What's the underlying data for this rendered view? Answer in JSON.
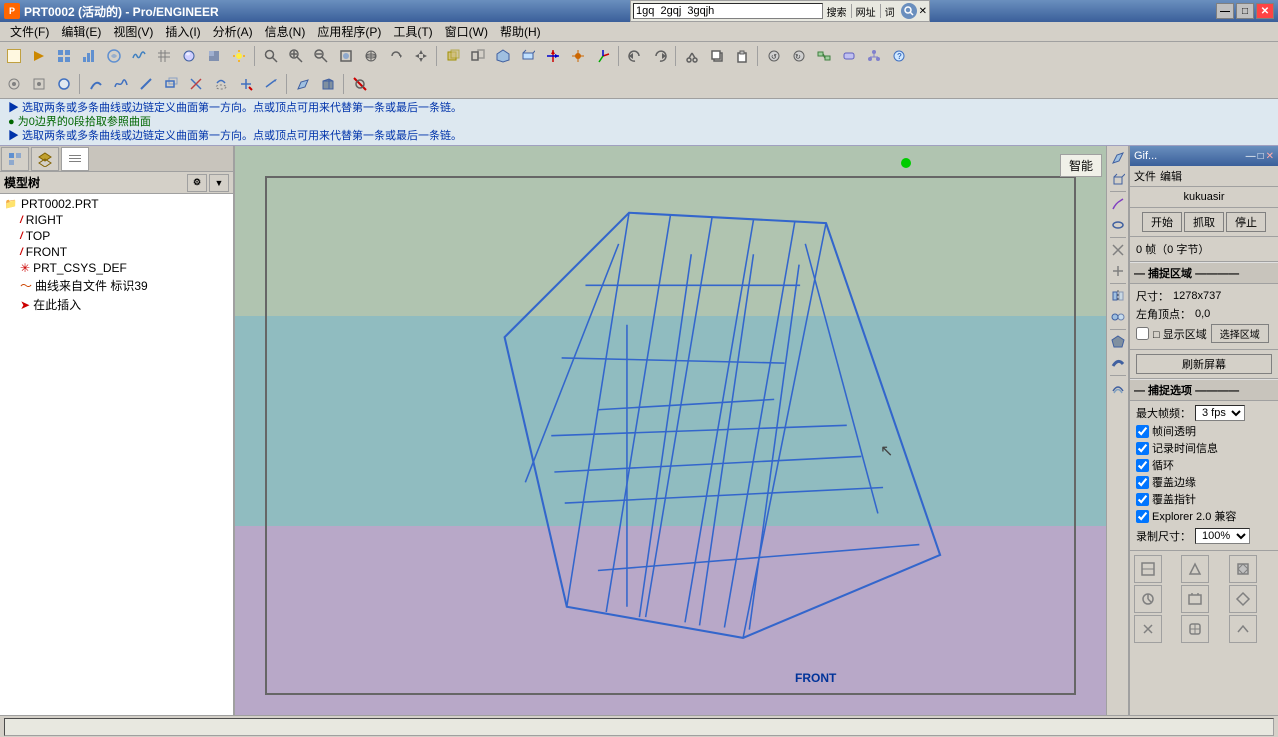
{
  "titleBar": {
    "title": "PRT0002 (活动的) - Pro/ENGINEER",
    "minimizeLabel": "—",
    "maximizeLabel": "□",
    "closeLabel": "✕"
  },
  "searchBar": {
    "text": "1gq  2gqj  3gqjh",
    "label1": "搜索",
    "label2": "网址",
    "label3": "词",
    "closeLabel": "✕"
  },
  "menuBar": {
    "items": [
      {
        "label": "文件(F)"
      },
      {
        "label": "编辑(E)"
      },
      {
        "label": "视图(V)"
      },
      {
        "label": "插入(I)"
      },
      {
        "label": "分析(A)"
      },
      {
        "label": "信息(N)"
      },
      {
        "label": "应用程序(P)"
      },
      {
        "label": "工具(T)"
      },
      {
        "label": "窗口(W)"
      },
      {
        "label": "帮助(H)"
      }
    ]
  },
  "instructions": [
    {
      "text": "▶ 选取两条或多条曲线或边链定义曲面第一方向。点或顶点可用来代替第一条或最后一条链。",
      "color": "blue"
    },
    {
      "text": "● 为0边界的0段拾取参照曲面",
      "color": "green"
    },
    {
      "text": "▶ 选取两条或多条曲线或边链定义曲面第一方向。点或顶点可用来代替第一条或最后一条链。",
      "color": "blue"
    }
  ],
  "leftPanel": {
    "tabs": [
      {
        "label": "模型树",
        "active": true
      },
      {
        "label": ""
      },
      {
        "label": ""
      }
    ],
    "treeHeader": "模型树",
    "tree": [
      {
        "level": 0,
        "icon": "folder",
        "label": "PRT0002.PRT"
      },
      {
        "level": 1,
        "icon": "plane",
        "label": "RIGHT"
      },
      {
        "level": 1,
        "icon": "plane",
        "label": "TOP"
      },
      {
        "level": 1,
        "icon": "plane",
        "label": "FRONT"
      },
      {
        "level": 1,
        "icon": "coord",
        "label": "PRT_CSYS_DEF"
      },
      {
        "level": 1,
        "icon": "curve",
        "label": "曲线来自文件 标识39"
      },
      {
        "level": 1,
        "icon": "insert",
        "label": "在此插入"
      }
    ]
  },
  "viewport": {
    "smartLabel": "智能",
    "frontLabel": "FRONT"
  },
  "rightPanel": {
    "title": "Gif...",
    "menuItems": [
      "文件",
      "编辑"
    ],
    "username": "kukuasir",
    "buttons": {
      "start": "开始",
      "capture": "抓取",
      "stop": "停止"
    },
    "frameInfo": "0 帧（0 字节）",
    "captureRegion": {
      "title": "— 捕捉区域 ————",
      "sizeLabel": "尺寸：",
      "sizeValue": "1278x737",
      "cornerLabel": "左角顶点：",
      "cornerValue": "0,0",
      "showRegion": "□ 显示区域",
      "selectRegion": "选择区域"
    },
    "refreshBtn": "刷新屏幕",
    "captureOptions": {
      "title": "— 捕捉选项 ————",
      "maxFpsLabel": "最大帧频：",
      "maxFpsValue": "3 fps",
      "options": [
        {
          "label": "帧间透明",
          "checked": true
        },
        {
          "label": "记录时间信息",
          "checked": true
        },
        {
          "label": "循环",
          "checked": true
        },
        {
          "label": "覆盖边缘",
          "checked": true
        },
        {
          "label": "覆盖指针",
          "checked": true
        },
        {
          "label": "Explorer 2.0 兼容",
          "checked": true
        }
      ],
      "recordSizeLabel": "录制尺寸：",
      "recordSizeValue": "100%"
    }
  },
  "statusBar": {
    "segment1": ""
  },
  "colors": {
    "viewport_top_band": "#b8cdb8",
    "viewport_mid_band": "#90c0c4",
    "viewport_bot_band": "#b8a8cc",
    "wireframe": "#3366cc",
    "accent": "#3a5f9a"
  }
}
